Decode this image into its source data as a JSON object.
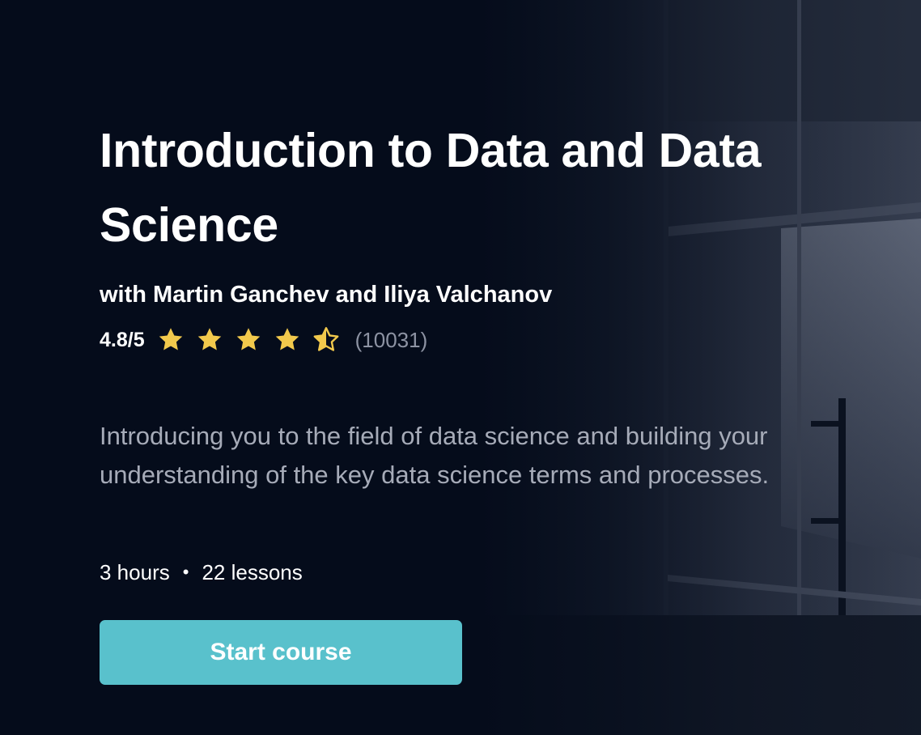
{
  "course": {
    "title": "Introduction to Data and Data Science",
    "instructors": "with Martin Ganchev and Iliya Valchanov",
    "rating": {
      "value_text": "4.8/5",
      "value": 4.8,
      "max": 5,
      "count_text": "(10031)",
      "stars": [
        "star-full",
        "star-full",
        "star-full",
        "star-full",
        "star-half"
      ]
    },
    "description": "Introducing you to the field of data science and building your understanding of the key data science terms and processes.",
    "duration": "3 hours",
    "separator": "•",
    "lessons": "22 lessons",
    "cta_label": "Start course"
  },
  "colors": {
    "background": "#050c1b",
    "accent": "#59c1cc",
    "star": "#f2c94c",
    "muted_text": "#a6abb8"
  }
}
